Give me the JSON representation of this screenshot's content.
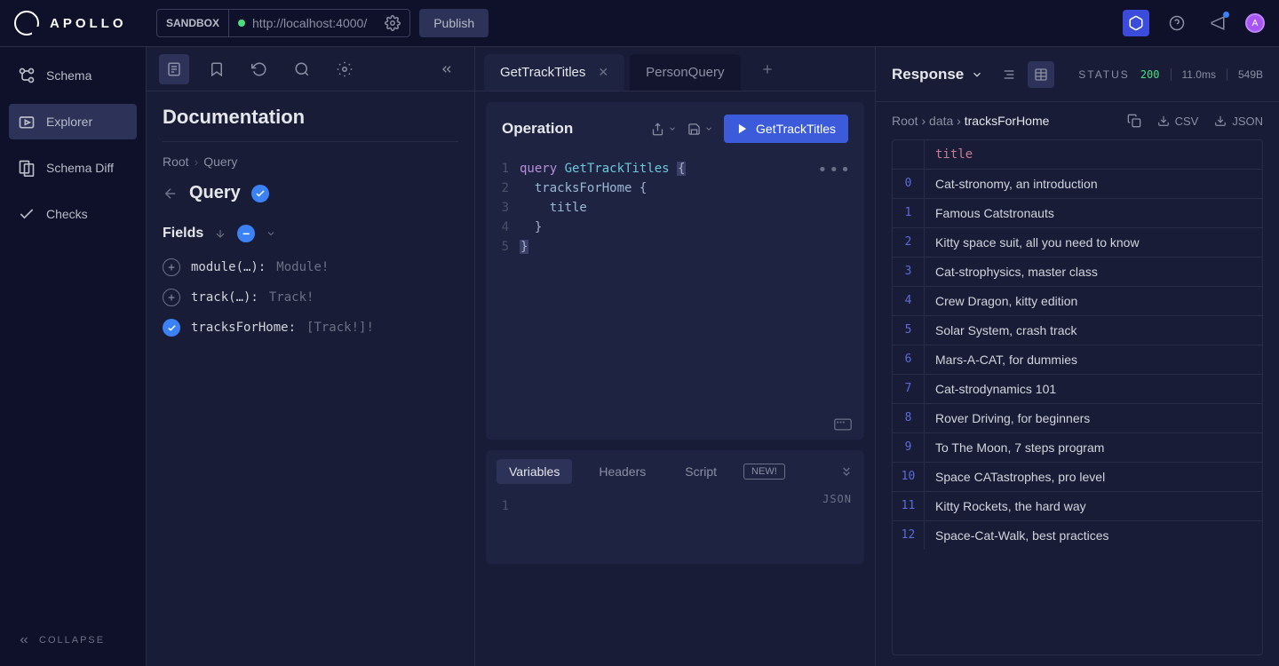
{
  "brand": "APOLLO",
  "sandbox": {
    "label": "SANDBOX",
    "url": "http://localhost:4000/",
    "publish": "Publish"
  },
  "nav": {
    "items": [
      {
        "label": "Schema",
        "id": "schema"
      },
      {
        "label": "Explorer",
        "id": "explorer"
      },
      {
        "label": "Schema Diff",
        "id": "schema-diff"
      },
      {
        "label": "Checks",
        "id": "checks"
      }
    ],
    "collapse": "COLLAPSE"
  },
  "docs": {
    "title": "Documentation",
    "crumb_root": "Root",
    "crumb_query": "Query",
    "query_title": "Query",
    "fields_label": "Fields",
    "fields": [
      {
        "name": "module(…): ",
        "type": "Module!",
        "added": false
      },
      {
        "name": "track(…): ",
        "type": "Track!",
        "added": false
      },
      {
        "name": "tracksForHome: ",
        "type": "[Track!]!",
        "added": true
      }
    ]
  },
  "tabs": [
    "GetTrackTitles",
    "PersonQuery"
  ],
  "operation": {
    "title": "Operation",
    "run_label": "GetTrackTitles",
    "code": {
      "l1_kw": "query",
      "l1_fn": " GetTrackTitles ",
      "l1_brace": "{",
      "l2": "  tracksForHome {",
      "l3": "    title",
      "l4": "  }",
      "l5": "}"
    }
  },
  "vars": {
    "tabs": [
      "Variables",
      "Headers",
      "Script"
    ],
    "new_badge": "NEW!",
    "json_label": "JSON"
  },
  "response": {
    "title": "Response",
    "status_label": "STATUS",
    "status_code": "200",
    "time": "11.0ms",
    "size": "549B",
    "crumbs": [
      "Root",
      "data",
      "tracksForHome"
    ],
    "actions": {
      "csv": "CSV",
      "json": "JSON"
    },
    "column": "title",
    "rows": [
      "Cat-stronomy, an introduction",
      "Famous Catstronauts",
      "Kitty space suit, all you need to know",
      "Cat-strophysics, master class",
      "Crew Dragon, kitty edition",
      "Solar System, crash track",
      "Mars-A-CAT, for dummies",
      "Cat-strodynamics 101",
      "Rover Driving, for beginners",
      "To The Moon, 7 steps program",
      "Space CATastrophes, pro level",
      "Kitty Rockets, the hard way",
      "Space-Cat-Walk, best practices"
    ]
  },
  "avatar_letter": "A"
}
